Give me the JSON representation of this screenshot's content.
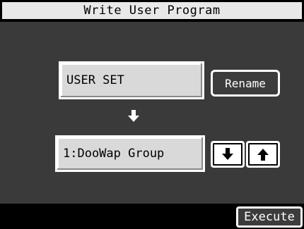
{
  "header": {
    "title": "Write User Program"
  },
  "main": {
    "user_set_label": "USER SET",
    "rename_label": "Rename",
    "program_value": "1:DooWap Group",
    "down_arrow_icon": "arrow-down-icon",
    "up_arrow_icon": "arrow-up-icon"
  },
  "footer": {
    "execute_label": "Execute"
  }
}
